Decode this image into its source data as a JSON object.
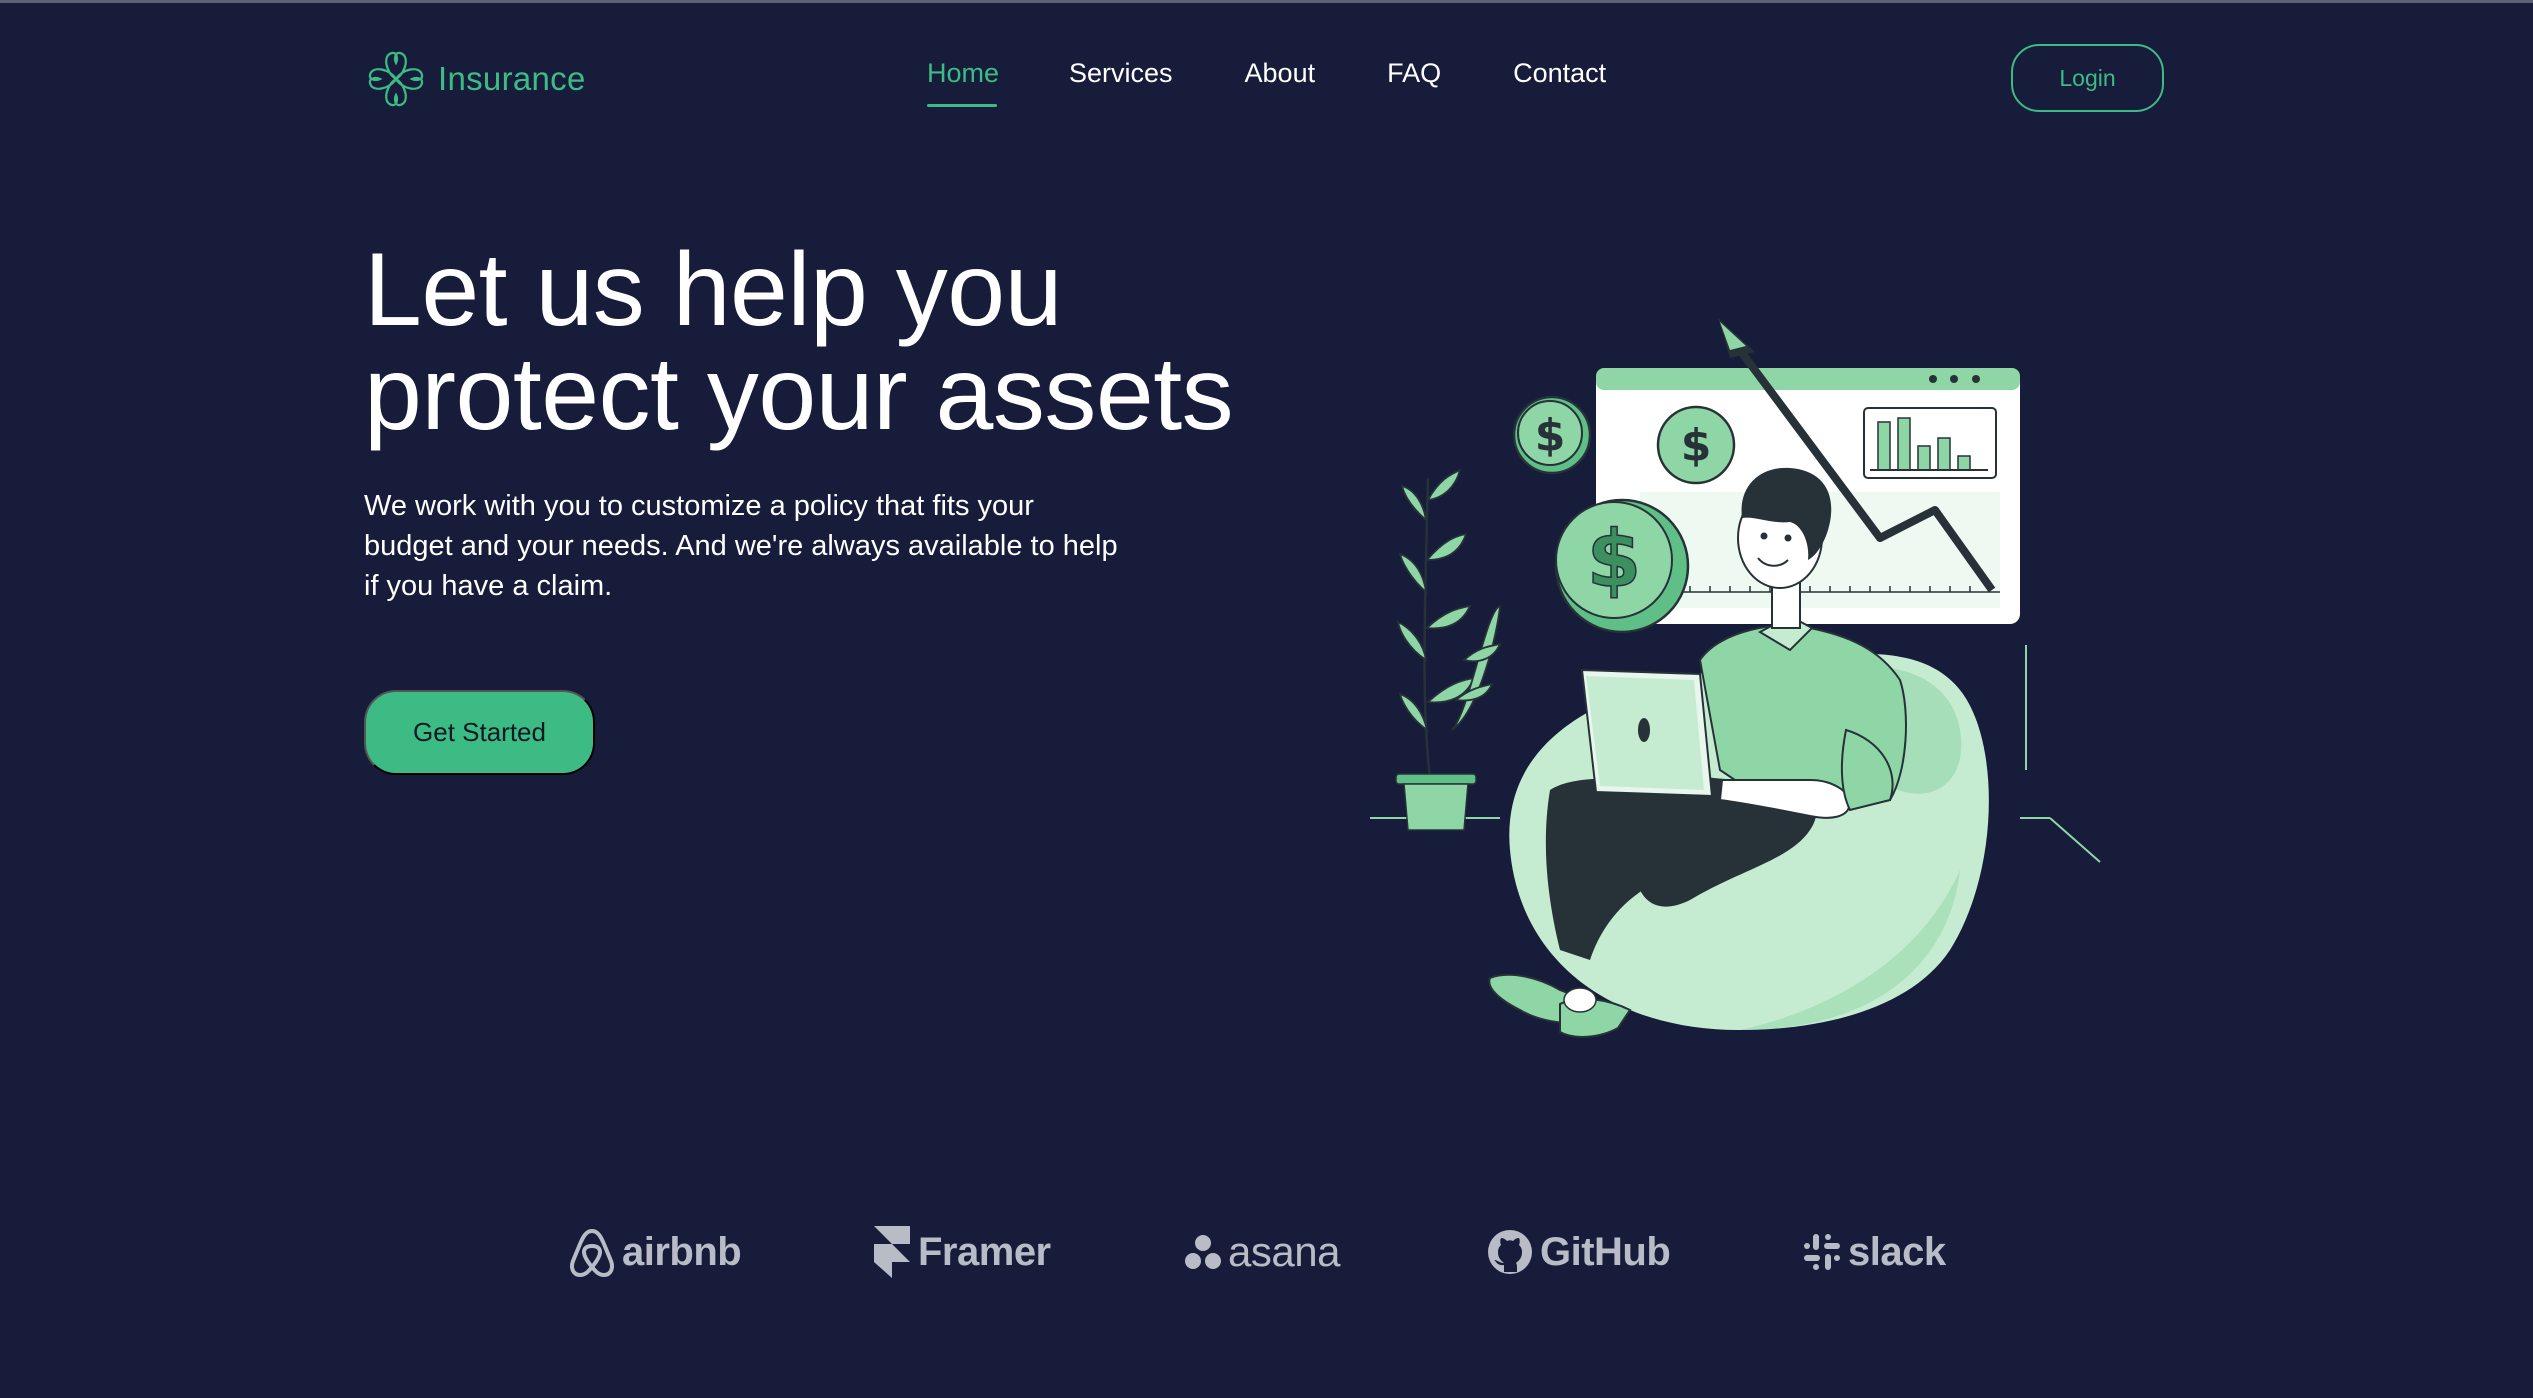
{
  "header": {
    "brand_name": "Insurance",
    "brand_icon": "clover-icon",
    "nav": [
      {
        "label": "Home",
        "active": true
      },
      {
        "label": "Services",
        "active": false
      },
      {
        "label": "About",
        "active": false
      },
      {
        "label": "FAQ",
        "active": false
      },
      {
        "label": "Contact",
        "active": false
      }
    ],
    "login_label": "Login"
  },
  "hero": {
    "title_line1": "Let us help you",
    "title_line2": "protect your assets",
    "description": "We work with you to customize a policy that fits your budget and your needs. And we're always available to help if you have a claim.",
    "cta_label": "Get Started"
  },
  "logos": [
    {
      "name": "airbnb",
      "icon": "airbnb-icon"
    },
    {
      "name": "Framer",
      "icon": "framer-icon"
    },
    {
      "name": "asana",
      "icon": "asana-icon"
    },
    {
      "name": "GitHub",
      "icon": "github-icon"
    },
    {
      "name": "slack",
      "icon": "slack-icon"
    }
  ],
  "colors": {
    "background": "#161c3a",
    "accent": "#3dbb85",
    "logo_gray": "#b8bcc6"
  }
}
